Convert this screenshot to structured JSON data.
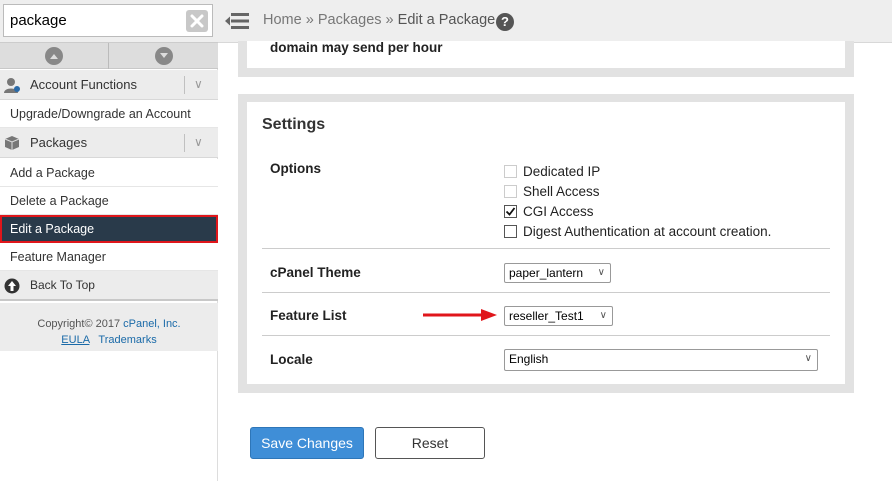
{
  "sidebar": {
    "search_value": "package",
    "categories": {
      "account_functions": "Account Functions",
      "packages": "Packages"
    },
    "items": {
      "upgrade": "Upgrade/Downgrade an Account",
      "add": "Add a Package",
      "delete": "Delete a Package",
      "edit": "Edit a Package",
      "feature_manager": "Feature Manager"
    },
    "back_to_top": "Back To Top",
    "footer": {
      "copyright_prefix": "Copyright© 2017 ",
      "company": "cPanel, Inc.",
      "eula": "EULA",
      "trademarks": "Trademarks"
    }
  },
  "breadcrumb": {
    "home": "Home",
    "sep": "»",
    "packages": "Packages",
    "current": "Edit a Package"
  },
  "main": {
    "top_text": "domain may send per hour",
    "settings_title": "Settings",
    "options_label": "Options",
    "options": [
      {
        "label": "Dedicated IP",
        "checked": false,
        "disabled": true
      },
      {
        "label": "Shell Access",
        "checked": false,
        "disabled": true
      },
      {
        "label": "CGI Access",
        "checked": true,
        "disabled": false
      },
      {
        "label": "Digest Authentication at account creation.",
        "checked": false,
        "disabled": false
      }
    ],
    "cpanel_theme_label": "cPanel Theme",
    "cpanel_theme_value": "paper_lantern",
    "feature_list_label": "Feature List",
    "feature_list_value": "reseller_Test1",
    "locale_label": "Locale",
    "locale_value": "English",
    "save_label": "Save Changes",
    "reset_label": "Reset"
  },
  "colors": {
    "active_nav_bg": "#293a4a",
    "highlight_border": "#e0161b",
    "primary_button": "#3f8ed7",
    "annotation_arrow": "#e0161b"
  }
}
